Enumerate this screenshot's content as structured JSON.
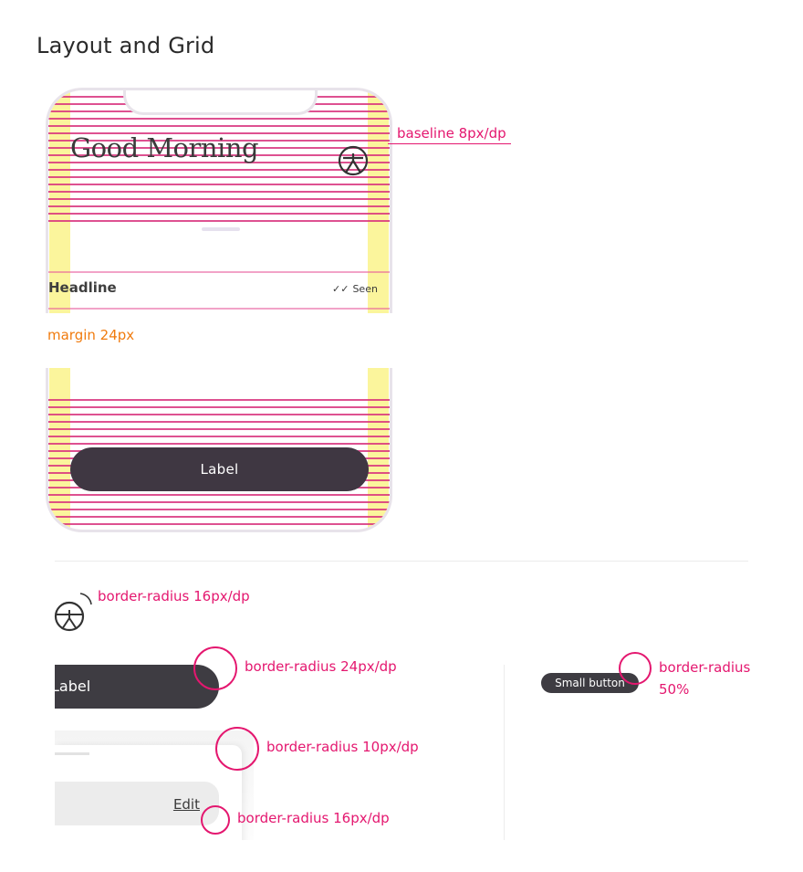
{
  "page": {
    "title": "Layout and Grid"
  },
  "phone": {
    "greeting": "Good Morning",
    "headline": "Headline",
    "seen_label": "Seen",
    "seen_check": "✓✓",
    "button_label": "Label"
  },
  "annotations": {
    "baseline": "baseline 8px/dp",
    "margin": "margin 24px",
    "icon_radius": "border-radius 16px/dp",
    "button_radius": "border-radius 24px/dp",
    "card_radius": "border-radius 10px/dp",
    "field_radius": "border-radius 16px/dp",
    "small_button_radius_line1": "border-radius",
    "small_button_radius_line2": "50%"
  },
  "samples": {
    "dark_button_label": "Label",
    "edit_label": "Edit",
    "small_button_label": "Small button"
  },
  "colors": {
    "accent": "#e4176f",
    "margin_highlight": "#fbf59c",
    "margin_text": "#f07b0e",
    "button_dark": "#3f3742"
  }
}
